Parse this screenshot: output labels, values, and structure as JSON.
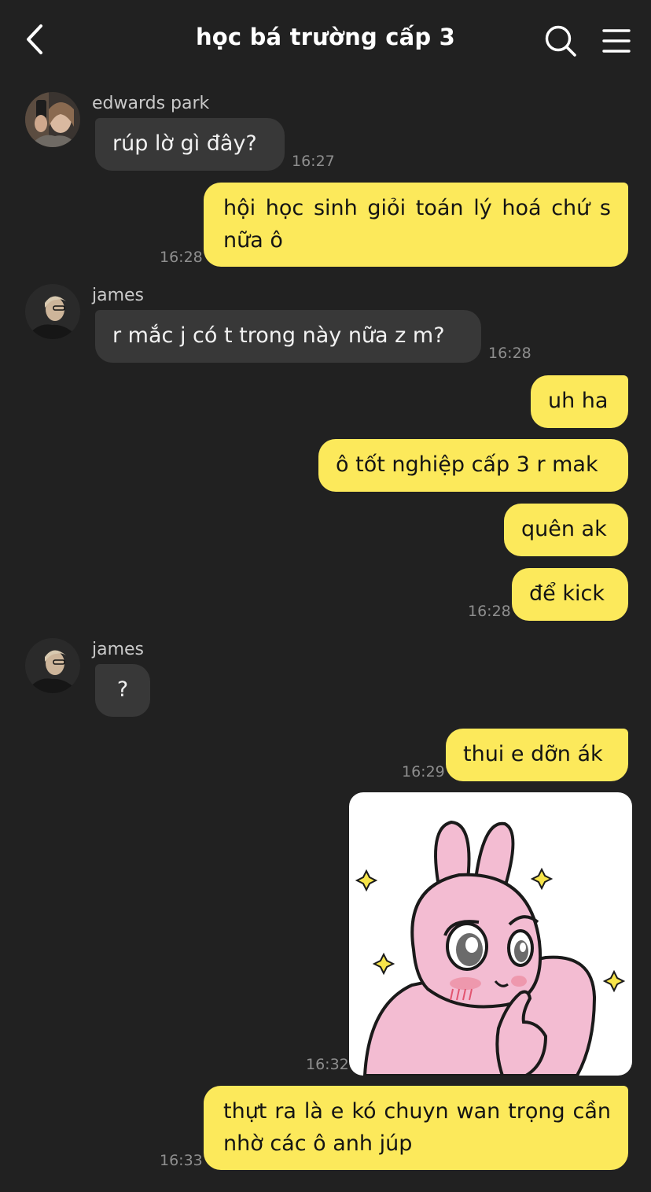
{
  "header": {
    "title": "học bá trường cấp 3",
    "back_icon": "chevron-left-icon",
    "search_icon": "search-icon",
    "menu_icon": "menu-icon"
  },
  "colors": {
    "background": "#212121",
    "incoming_bubble": "#383838",
    "outgoing_bubble": "#fce95b",
    "timestamp": "#8e8e8e"
  },
  "messages": [
    {
      "sender": "edwards park",
      "text": "rúp lờ gì đây?",
      "time": "16:27"
    },
    {
      "text": "hội học sinh giỏi toán lý hoá chứ s nữa ô",
      "time": "16:28"
    },
    {
      "sender": "james",
      "text": "r mắc j có t trong này nữa z m?",
      "time": "16:28"
    },
    {
      "text": "uh ha"
    },
    {
      "text": "ô tốt nghiệp cấp 3 r mak"
    },
    {
      "text": "quên ak"
    },
    {
      "text": "để kick",
      "time": "16:28"
    },
    {
      "sender": "james",
      "text": "?"
    },
    {
      "text": "thui e dỡn ák",
      "time": "16:29"
    },
    {
      "sticker": "pink-bunny-thinking-sticker",
      "time": "16:32"
    },
    {
      "text": "thựt ra là e kó chuyn wan trọng cần nhờ các ô anh júp",
      "time": "16:33"
    }
  ]
}
